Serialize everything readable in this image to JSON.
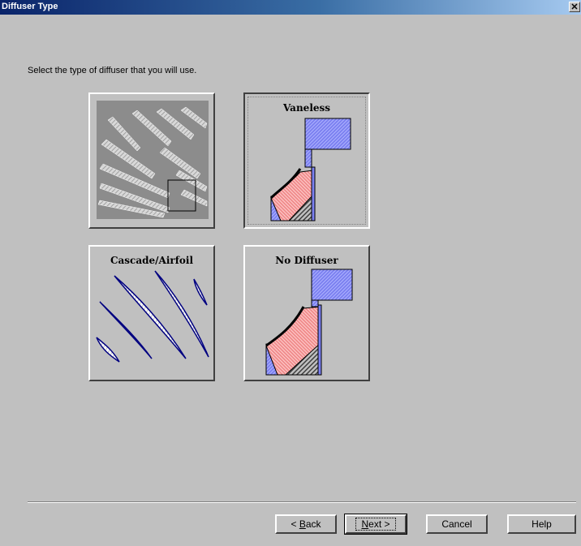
{
  "window": {
    "title": "Diffuser Type",
    "close_glyph": "✕"
  },
  "instruction": "Select the type of diffuser that you will use.",
  "options": [
    {
      "label": "",
      "id": "vaned",
      "icon": "vaned-diffuser-icon",
      "selected": false
    },
    {
      "label": "Vaneless",
      "id": "vaneless",
      "icon": "vaneless-diffuser-icon",
      "selected": true
    },
    {
      "label": "Cascade/Airfoil",
      "id": "cascade",
      "icon": "cascade-airfoil-icon",
      "selected": false
    },
    {
      "label": "No Diffuser",
      "id": "none",
      "icon": "no-diffuser-icon",
      "selected": false
    }
  ],
  "buttons": {
    "back": {
      "pre": "< ",
      "mnemonic": "B",
      "post": "ack"
    },
    "next": {
      "mnemonic": "N",
      "post": "ext >"
    },
    "cancel": "Cancel",
    "help": "Help"
  },
  "colors": {
    "blue": "#7b80f0",
    "red": "#f08c8c",
    "hatch": "#808080"
  }
}
